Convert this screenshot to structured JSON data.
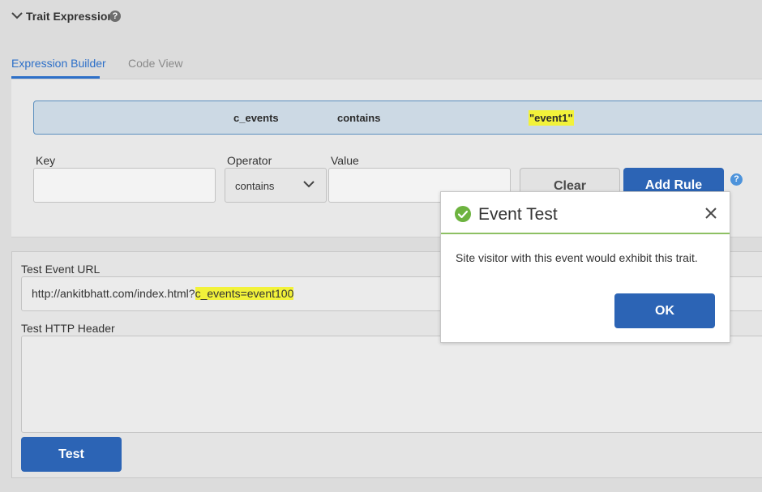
{
  "section": {
    "title": "Trait Expression",
    "help_glyph": "?",
    "chevron_icon": "chevron-down-icon"
  },
  "tabs": [
    {
      "label": "Expression Builder",
      "active": true
    },
    {
      "label": "Code View",
      "active": false
    }
  ],
  "rule": {
    "key": "c_events",
    "operator": "contains",
    "value": "\"event1\""
  },
  "builder": {
    "key_label": "Key",
    "operator_label": "Operator",
    "value_label": "Value",
    "key_value": "",
    "operator_value": "contains",
    "value_value": "",
    "clear_label": "Clear",
    "add_rule_label": "Add Rule",
    "help_glyph": "?"
  },
  "test": {
    "url_label": "Test Event URL",
    "url_prefix": "http://ankitbhatt.com/index.html?",
    "url_query": "c_events=event100",
    "header_label": "Test HTTP Header",
    "header_value": "",
    "test_label": "Test"
  },
  "dialog": {
    "title": "Event Test",
    "message": "Site visitor with this event would exhibit this trait.",
    "ok_label": "OK",
    "status_icon": "check-circle-icon",
    "close_icon": "close-icon"
  },
  "colors": {
    "accent": "#2c64b5",
    "tab_active": "#2c6fc8",
    "highlight": "#f2f23a",
    "success": "#6db33f"
  }
}
